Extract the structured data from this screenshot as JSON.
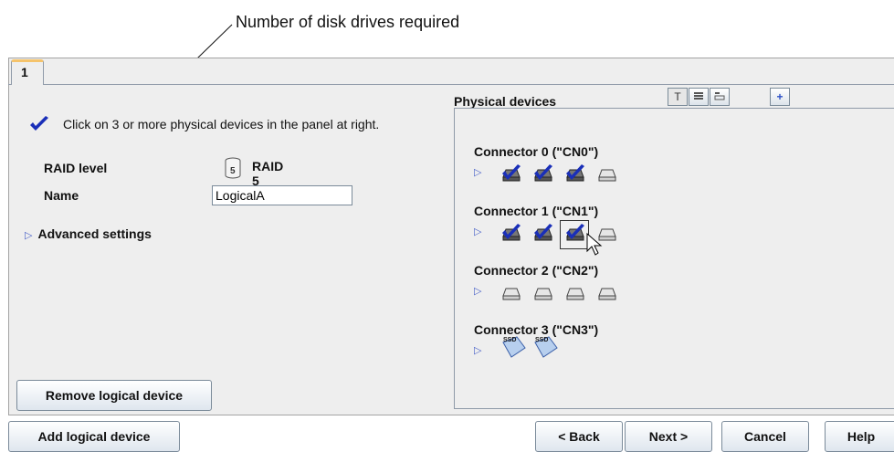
{
  "annotation": {
    "label": "Number of disk drives required"
  },
  "tab": {
    "label": "1"
  },
  "instruction": {
    "text": "Click on 3 or more physical devices in the panel at right."
  },
  "raid": {
    "label": "RAID level",
    "value": "RAID 5",
    "icon": "raid-5-icon",
    "icon_digit": "5"
  },
  "name": {
    "label": "Name",
    "value": "LogicalA"
  },
  "advanced": {
    "label": "Advanced settings"
  },
  "physical": {
    "title": "Physical devices",
    "view_buttons": [
      "T",
      "list",
      "detail",
      "+"
    ],
    "connectors": [
      {
        "label": "Connector 0 (\"CN0\")",
        "devices": [
          "selected",
          "selected",
          "selected",
          "disk"
        ]
      },
      {
        "label": "Connector 1 (\"CN1\")",
        "devices": [
          "selected",
          "selected",
          "selected-focus",
          "disk"
        ]
      },
      {
        "label": "Connector 2 (\"CN2\")",
        "devices": [
          "disk",
          "disk",
          "disk",
          "disk"
        ]
      },
      {
        "label": "Connector 3 (\"CN3\")",
        "devices": [
          "ssd",
          "ssd"
        ]
      }
    ],
    "ssd_label": "SSD"
  },
  "buttons": {
    "remove": "Remove logical device",
    "add": "Add logical device",
    "back": "< Back",
    "next": "Next >",
    "cancel": "Cancel",
    "help": "Help"
  },
  "colors": {
    "accent": "#1a2fb8",
    "tab_highlight": "#f5c36b",
    "panel": "#eeeeee",
    "ssd": "#b7cfee"
  }
}
